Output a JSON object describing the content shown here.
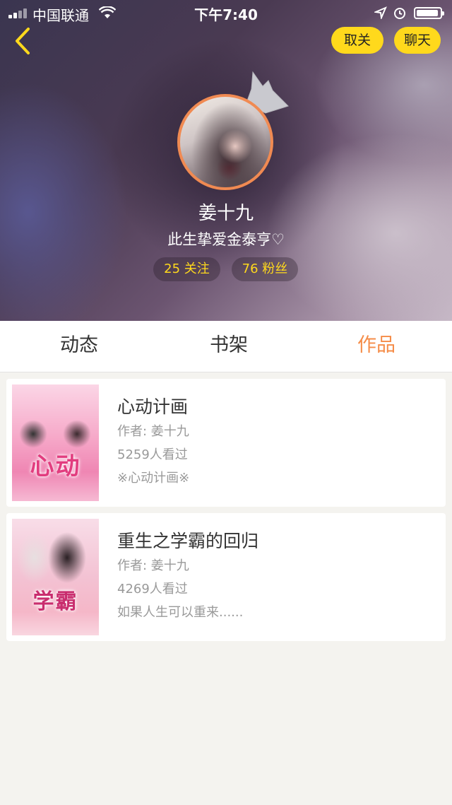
{
  "status_bar": {
    "carrier": "中国联通",
    "time": "下午7:40"
  },
  "header": {
    "unfollow_label": "取关",
    "chat_label": "聊天"
  },
  "profile": {
    "username": "姜十九",
    "bio": "此生挚爱金泰亨♡",
    "following": "25 关注",
    "followers": "76 粉丝"
  },
  "tabs": [
    {
      "label": "动态"
    },
    {
      "label": "书架"
    },
    {
      "label": "作品",
      "active": true
    }
  ],
  "works": [
    {
      "cover_text": "心动",
      "title": "心动计画",
      "author": "作者: 姜十九",
      "views": "5259人看过",
      "description": "※心动计画※"
    },
    {
      "cover_text": "学霸",
      "title": "重生之学霸的回归",
      "author": "作者: 姜十九",
      "views": "4269人看过",
      "description": "如果人生可以重来......"
    }
  ],
  "colors": {
    "accent_yellow": "#ffd91c",
    "accent_orange": "#f58c48",
    "background": "#f4f3ef"
  }
}
